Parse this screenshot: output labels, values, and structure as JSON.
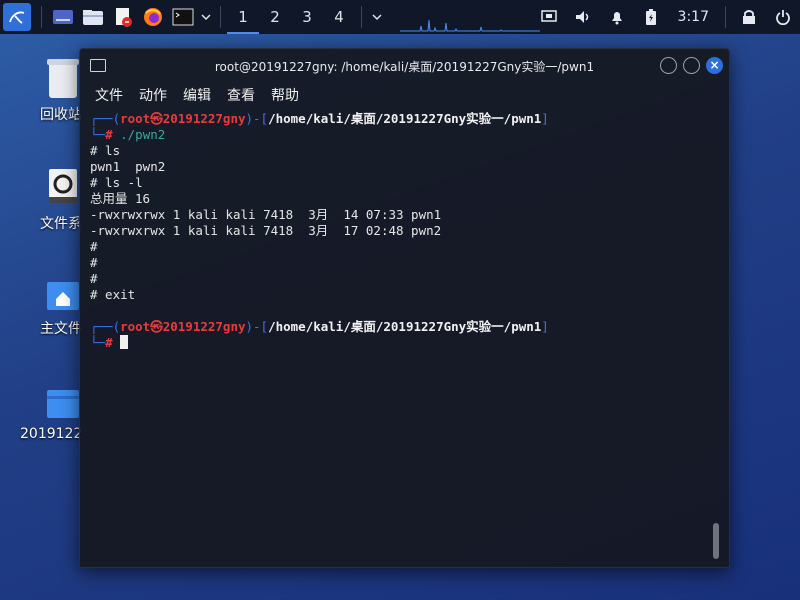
{
  "panel": {
    "workspaces": [
      "1",
      "2",
      "3",
      "4"
    ],
    "clock": "3:17",
    "icons": [
      "kali-menu-icon",
      "show-desktop-icon",
      "file-manager-icon",
      "text-editor-icon",
      "firefox-icon",
      "terminal-icon"
    ]
  },
  "desktop": {
    "trash_label": "回收站",
    "filesystem_label": "文件系",
    "home_label": "主文件",
    "folder_label": "2019122"
  },
  "terminal": {
    "title": "root@20191227gny: /home/kali/桌面/20191227Gny实验一/pwn1",
    "menu": [
      "文件",
      "动作",
      "编辑",
      "查看",
      "帮助"
    ],
    "prompt_user": "root㉿20191227gny",
    "prompt_path": "/home/kali/桌面/20191227Gny实验一/pwn1",
    "lines": {
      "cmd1": "./pwn2",
      "l1": "# ls",
      "l2": "pwn1  pwn2",
      "l3": "# ls -l",
      "l4": "总用量 16",
      "l5": "-rwxrwxrwx 1 kali kali 7418  3月  14 07:33 pwn1",
      "l6": "-rwxrwxrwx 1 kali kali 7418  3月  17 02:48 pwn2",
      "l7": "#",
      "l8": "#",
      "l9": "#",
      "l10": "# exit"
    },
    "prompt_symbol": "#"
  }
}
